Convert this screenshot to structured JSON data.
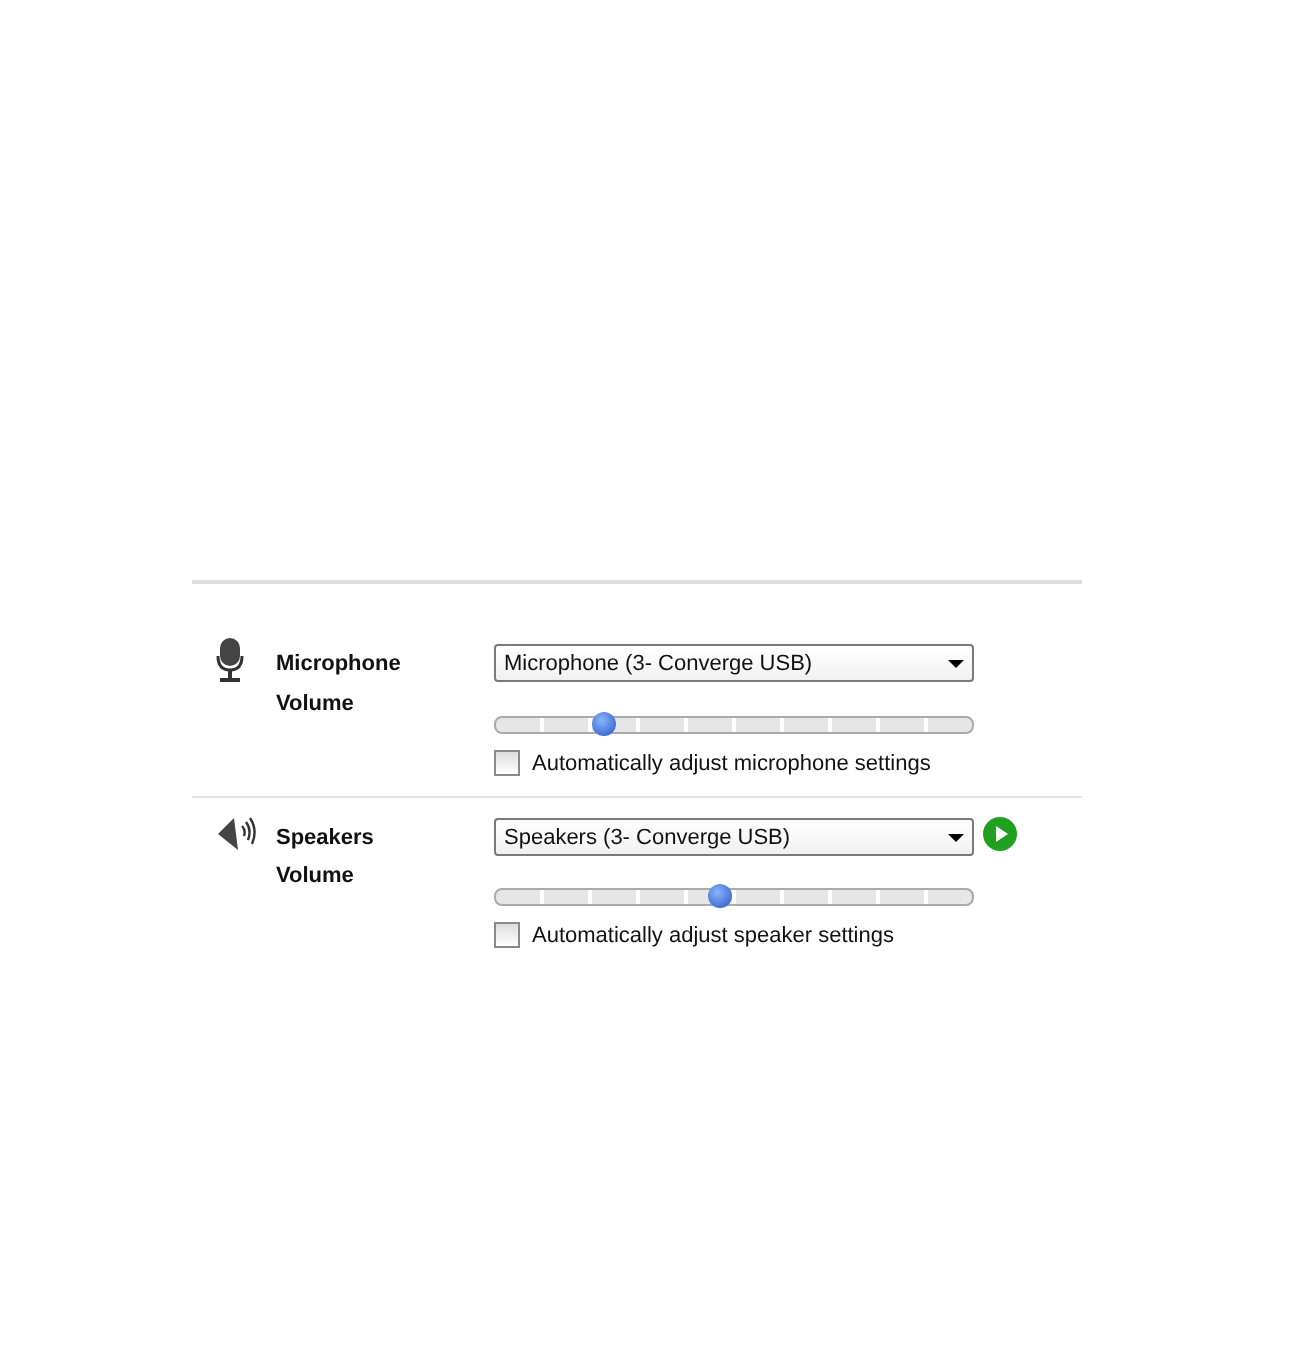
{
  "devices": [
    {
      "kind": "microphone",
      "label": "Microphone",
      "device": "Microphone (3- Converge USB)",
      "volume_label": "Volume",
      "level": 0.225,
      "auto_adjust": {
        "label": "Automatically adjust microphone settings",
        "checked": false
      },
      "test_button": false
    },
    {
      "kind": "speakers",
      "label": "Speakers",
      "device": "Speakers (3- Converge USB)",
      "volume_label": "Volume",
      "level": 0.47,
      "auto_adjust": {
        "label": "Automatically adjust speaker settings",
        "checked": false
      },
      "test_button": true
    }
  ]
}
